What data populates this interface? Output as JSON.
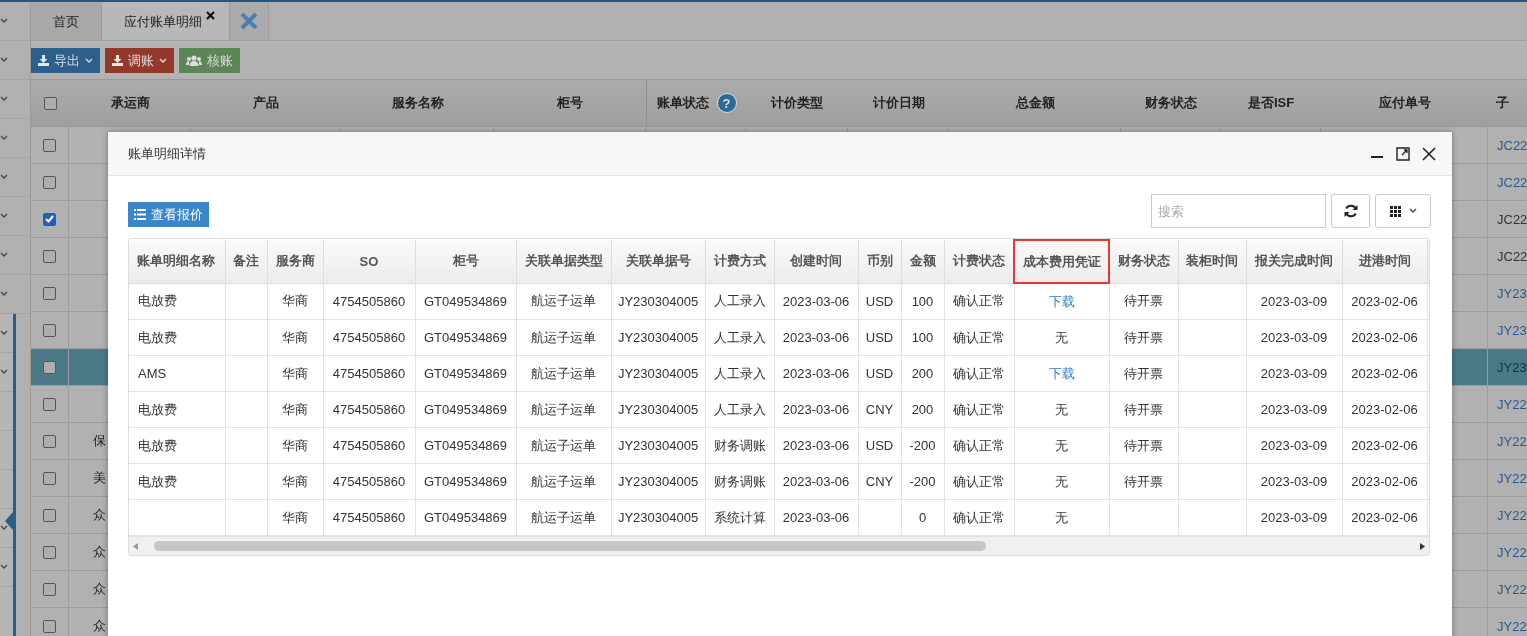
{
  "tabs": [
    {
      "label": "首页",
      "selected": false,
      "closable": false
    },
    {
      "label": "应付账单明细",
      "selected": true,
      "closable": true
    }
  ],
  "toolbar": [
    {
      "label": "导出",
      "color": "#2d5f8c",
      "dropdown": true
    },
    {
      "label": "调账",
      "color": "#92392c",
      "dropdown": true
    },
    {
      "label": "核账",
      "color": "#5c8655",
      "dropdown": false
    }
  ],
  "table": {
    "all_checked": false,
    "columns": [
      {
        "label": "承运商"
      },
      {
        "label": "产品"
      },
      {
        "label": "服务名称"
      },
      {
        "label": "柜号"
      },
      {
        "label": "账单状态",
        "help": "?"
      },
      {
        "label": "计价类型"
      },
      {
        "label": "计价日期"
      },
      {
        "label": "总金额"
      },
      {
        "label": "财务状态"
      },
      {
        "label": "是否ISF"
      },
      {
        "label": "应付单号"
      },
      {
        "label": "子"
      }
    ],
    "rows": [
      {
        "checked": false,
        "selected": false,
        "column_2": null,
        "column_13": {
          "text": "JC22",
          "link": true
        }
      },
      {
        "checked": false,
        "selected": false,
        "column_2": null,
        "column_13": {
          "text": "JC22",
          "link": true
        }
      },
      {
        "checked": true,
        "selected": false,
        "column_2": null,
        "column_13": {
          "text": "JC22",
          "link": false
        }
      },
      {
        "checked": false,
        "selected": false,
        "column_2": null,
        "column_13": {
          "text": "JC22",
          "link": false
        }
      },
      {
        "checked": false,
        "selected": false,
        "column_2": null,
        "column_13": {
          "text": "JY23",
          "link": true
        }
      },
      {
        "checked": false,
        "selected": false,
        "column_2": null,
        "column_13": {
          "text": "JY23",
          "link": true
        }
      },
      {
        "checked": false,
        "selected": true,
        "column_2": null,
        "column_13": {
          "text": "JY23",
          "link": true
        }
      },
      {
        "checked": false,
        "selected": false,
        "column_2": null,
        "column_13": {
          "text": "JY22",
          "link": true
        }
      },
      {
        "checked": false,
        "selected": false,
        "column_2": "保",
        "column_13": {
          "text": "JY22",
          "link": true
        }
      },
      {
        "checked": false,
        "selected": false,
        "column_2": "美",
        "column_13": {
          "text": "JY22",
          "link": true
        }
      },
      {
        "checked": false,
        "selected": false,
        "column_2": "众",
        "column_13": {
          "text": "JY22",
          "link": true
        }
      },
      {
        "checked": false,
        "selected": false,
        "column_2": "众",
        "column_13": {
          "text": "JY22",
          "link": true
        }
      },
      {
        "checked": false,
        "selected": false,
        "column_2": "众",
        "column_13": {
          "text": "JY22",
          "link": true
        }
      },
      {
        "checked": false,
        "selected": false,
        "column_2": "众",
        "column_13": {
          "text": "JY22",
          "link": true
        }
      }
    ]
  },
  "dialog": {
    "title": "账单明细详情",
    "quote_button": "查看报价",
    "search": {
      "placeholder": "搜索"
    },
    "table": {
      "columns": [
        {
          "label": "账单明细名称",
          "highlighted": false
        },
        {
          "label": "备注",
          "highlighted": false
        },
        {
          "label": "服务商",
          "highlighted": false
        },
        {
          "label": "SO",
          "highlighted": false
        },
        {
          "label": "柜号",
          "highlighted": false
        },
        {
          "label": "关联单据类型",
          "highlighted": false
        },
        {
          "label": "关联单据号",
          "highlighted": false
        },
        {
          "label": "计费方式",
          "highlighted": false
        },
        {
          "label": "创建时间",
          "highlighted": false
        },
        {
          "label": "币别",
          "highlighted": false
        },
        {
          "label": "金额",
          "highlighted": false
        },
        {
          "label": "计费状态",
          "highlighted": false
        },
        {
          "label": "成本费用凭证",
          "highlighted": true
        },
        {
          "label": "财务状态",
          "highlighted": false
        },
        {
          "label": "装柜时间",
          "highlighted": false
        },
        {
          "label": "报关完成时间",
          "highlighted": false
        },
        {
          "label": "进港时间",
          "highlighted": false
        }
      ],
      "rows": [
        [
          "电放费",
          null,
          "华商",
          "4754505860",
          "GT049534869",
          "航运子运单",
          "JY230304005",
          "人工录入",
          "2023-03-06",
          "USD",
          "100",
          "确认正常",
          {
            "text": "下载",
            "link": true
          },
          "待开票",
          null,
          "2023-03-09",
          "2023-02-06"
        ],
        [
          "电放费",
          null,
          "华商",
          "4754505860",
          "GT049534869",
          "航运子运单",
          "JY230304005",
          "人工录入",
          "2023-03-06",
          "USD",
          "100",
          "确认正常",
          {
            "text": "无",
            "link": false
          },
          "待开票",
          null,
          "2023-03-09",
          "2023-02-06"
        ],
        [
          "AMS",
          null,
          "华商",
          "4754505860",
          "GT049534869",
          "航运子运单",
          "JY230304005",
          "人工录入",
          "2023-03-06",
          "USD",
          "200",
          "确认正常",
          {
            "text": "下载",
            "link": true
          },
          "待开票",
          null,
          "2023-03-09",
          "2023-02-06"
        ],
        [
          "电放费",
          null,
          "华商",
          "4754505860",
          "GT049534869",
          "航运子运单",
          "JY230304005",
          "人工录入",
          "2023-03-06",
          "CNY",
          "200",
          "确认正常",
          {
            "text": "无",
            "link": false
          },
          "待开票",
          null,
          "2023-03-09",
          "2023-02-06"
        ],
        [
          "电放费",
          null,
          "华商",
          "4754505860",
          "GT049534869",
          "航运子运单",
          "JY230304005",
          "财务调账",
          "2023-03-06",
          "USD",
          "-200",
          "确认正常",
          {
            "text": "无",
            "link": false
          },
          "待开票",
          null,
          "2023-03-09",
          "2023-02-06"
        ],
        [
          "电放费",
          null,
          "华商",
          "4754505860",
          "GT049534869",
          "航运子运单",
          "JY230304005",
          "财务调账",
          "2023-03-06",
          "CNY",
          "-200",
          "确认正常",
          {
            "text": "无",
            "link": false
          },
          "待开票",
          null,
          "2023-03-09",
          "2023-02-06"
        ],
        [
          null,
          null,
          "华商",
          "4754505860",
          "GT049534869",
          "航运子运单",
          "JY230304005",
          "系统计算",
          "2023-03-06",
          null,
          "0",
          "确认正常",
          {
            "text": "无",
            "link": false
          },
          null,
          null,
          "2023-03-09",
          "2023-02-06"
        ]
      ]
    }
  }
}
